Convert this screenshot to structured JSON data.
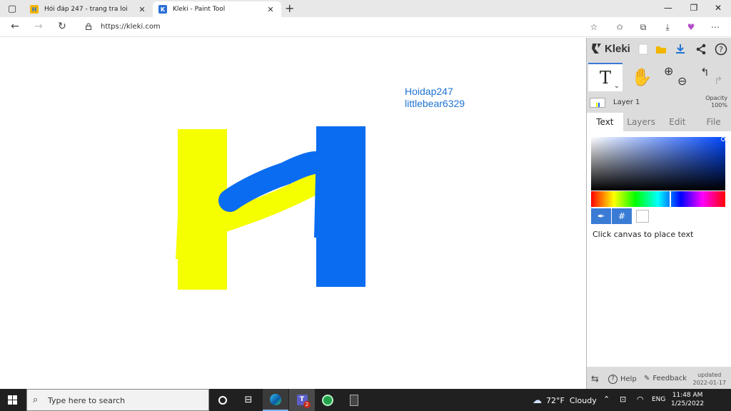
{
  "browser": {
    "tabs": [
      {
        "title": "Hỏi đáp 247 - trang tra loi",
        "favicon": "hoidap-favicon",
        "active": false
      },
      {
        "title": "Kleki - Paint Tool",
        "favicon": "kleki-favicon",
        "active": true
      }
    ],
    "new_tab": "+",
    "url": "https://kleki.com"
  },
  "canvas": {
    "text_lines": [
      "Hoidap247",
      "littlebear6329"
    ],
    "text_color": "#1e73d2",
    "stroke_colors": {
      "yellow": "#f5ff00",
      "blue": "#0a6cf0"
    }
  },
  "kleki": {
    "logo_text": "Kleki",
    "tool_text_glyph": "T",
    "layer_name": "Layer 1",
    "opacity_label": "Opacity",
    "opacity_value": "100%",
    "tabs": [
      "Text",
      "Layers",
      "Edit",
      "File"
    ],
    "active_tab": "Text",
    "hex_symbol": "#",
    "hint": "Click canvas to place text",
    "footer": {
      "help": "Help",
      "feedback": "Feedback",
      "updated_label": "updated",
      "updated_date": "2022-01-17"
    },
    "accent_color": "#3a7bd5"
  },
  "taskbar": {
    "search_placeholder": "Type here to search",
    "weather": "72°F  Cloudy",
    "language": "ENG",
    "time": "11:48 AM",
    "date": "1/25/2022",
    "teams_badge": "2"
  }
}
